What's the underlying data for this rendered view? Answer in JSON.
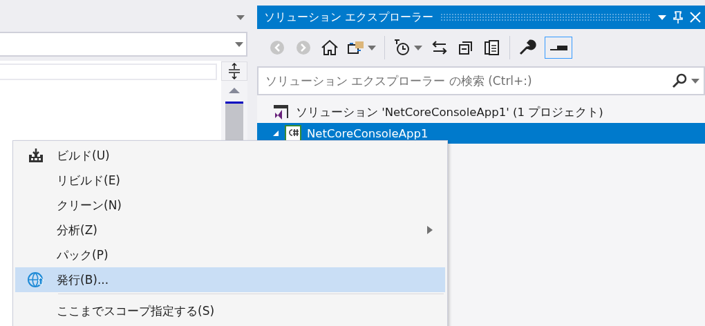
{
  "solution_explorer": {
    "title": "ソリューション エクスプローラー",
    "search": {
      "placeholder": "ソリューション エクスプローラー の検索 (Ctrl+:)"
    },
    "tree": [
      {
        "kind": "solution",
        "label": "ソリューション 'NetCoreConsoleApp1' (1 プロジェクト)",
        "selected": false
      },
      {
        "kind": "project",
        "label": "NetCoreConsoleApp1",
        "selected": true,
        "expanded": true
      }
    ]
  },
  "context_menu": [
    {
      "kind": "build",
      "label": "ビルド(U)",
      "selected": false
    },
    {
      "kind": "plain",
      "label": "リビルド(E)",
      "selected": false
    },
    {
      "kind": "plain",
      "label": "クリーン(N)",
      "selected": false
    },
    {
      "kind": "submenu",
      "label": "分析(Z)",
      "selected": false
    },
    {
      "kind": "plain",
      "label": "パック(P)",
      "selected": false
    },
    {
      "kind": "publish",
      "label": "発行(B)...",
      "selected": true
    },
    {
      "kind": "separator"
    },
    {
      "kind": "plain",
      "label": "ここまでスコープ指定する(S)",
      "selected": false
    }
  ]
}
